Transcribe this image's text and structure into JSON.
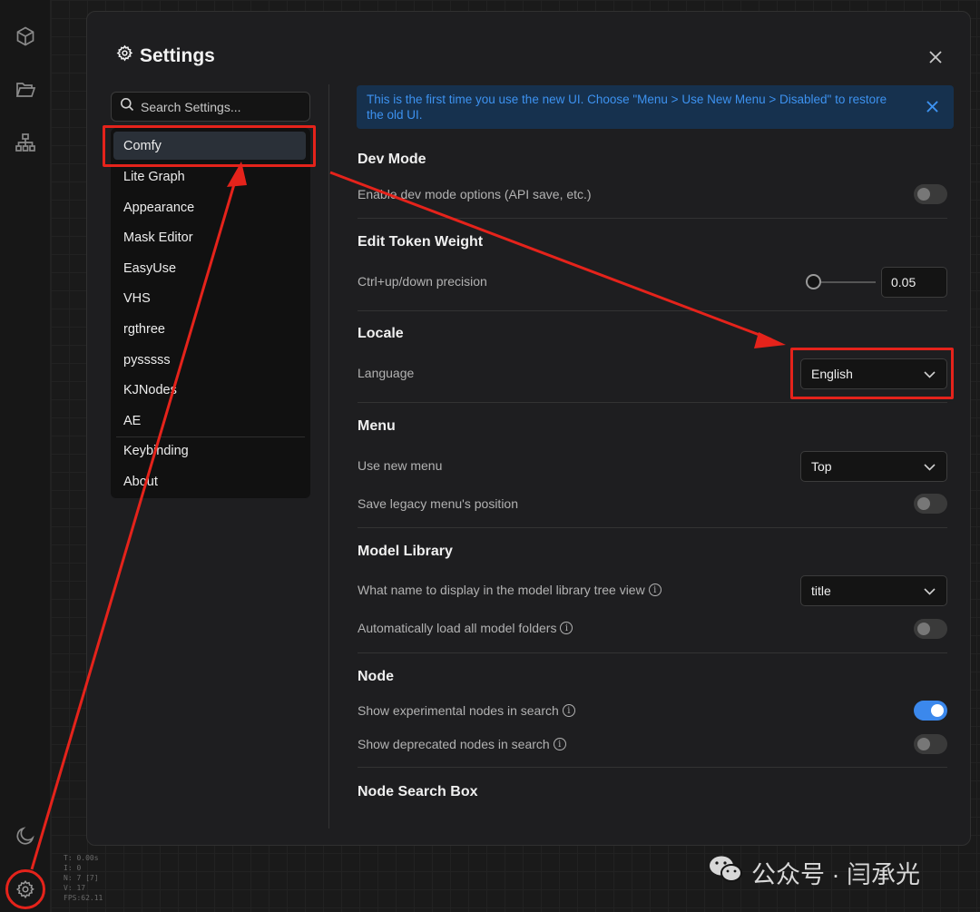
{
  "dialog": {
    "title": "Settings",
    "search_placeholder": "Search Settings..."
  },
  "nav": {
    "items": [
      {
        "label": "Comfy",
        "active": true
      },
      {
        "label": "Lite Graph"
      },
      {
        "label": "Appearance"
      },
      {
        "label": "Mask Editor"
      },
      {
        "label": "EasyUse"
      },
      {
        "label": "VHS"
      },
      {
        "label": "rgthree"
      },
      {
        "label": "pysssss"
      },
      {
        "label": "KJNodes"
      },
      {
        "label": "AE"
      },
      {
        "label": "Keybinding"
      },
      {
        "label": "About"
      }
    ]
  },
  "banner": {
    "text": "This is the first time you use the new UI. Choose \"Menu > Use New Menu > Disabled\" to restore the old UI."
  },
  "sections": {
    "dev_mode": {
      "title": "Dev Mode",
      "enable_label": "Enable dev mode options (API save, etc.)",
      "enable_value": false
    },
    "edit_token_weight": {
      "title": "Edit Token Weight",
      "precision_label": "Ctrl+up/down precision",
      "precision_value": "0.05"
    },
    "locale": {
      "title": "Locale",
      "language_label": "Language",
      "language_value": "English"
    },
    "menu": {
      "title": "Menu",
      "use_new_menu_label": "Use new menu",
      "use_new_menu_value": "Top",
      "save_legacy_label": "Save legacy menu's position",
      "save_legacy_value": false
    },
    "model_library": {
      "title": "Model Library",
      "display_name_label": "What name to display in the model library tree view",
      "display_name_value": "title",
      "auto_load_label": "Automatically load all model folders",
      "auto_load_value": false
    },
    "node": {
      "title": "Node",
      "experimental_label": "Show experimental nodes in search",
      "experimental_value": true,
      "deprecated_label": "Show deprecated nodes in search",
      "deprecated_value": false
    },
    "node_search_box": {
      "title": "Node Search Box"
    }
  },
  "stats": [
    "T: 0.00s",
    "I: 0",
    "N: 7 [7]",
    "V: 17",
    "FPS:62.11"
  ],
  "watermark": {
    "text": "公众号 · 闫承光"
  },
  "colors": {
    "accent": "#3b88ec",
    "annotation": "#e5231b",
    "banner_bg": "#16314e",
    "banner_text": "#3d92f0"
  }
}
